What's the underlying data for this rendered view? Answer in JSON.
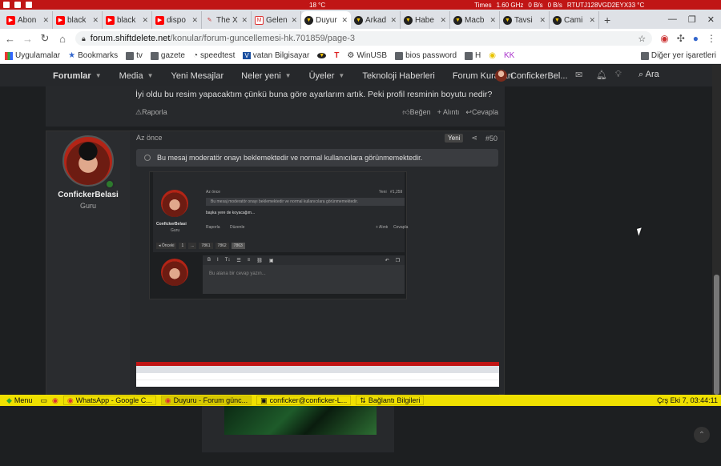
{
  "system_bar": {
    "items": [
      "18 °C",
      "Times",
      "1.60 GHz",
      "0 B/s",
      "0 B/s",
      "RTUTJ128VGD2EYX33 °C"
    ]
  },
  "tabs": [
    {
      "label": "Abon",
      "icon": "youtube-icon",
      "active": false
    },
    {
      "label": "black",
      "icon": "youtube-icon",
      "active": false
    },
    {
      "label": "black",
      "icon": "youtube-icon",
      "active": false
    },
    {
      "label": "dispo",
      "icon": "youtube-icon",
      "active": false
    },
    {
      "label": "The X",
      "icon": "pen-icon",
      "active": false
    },
    {
      "label": "Gelen",
      "icon": "gmail-icon",
      "active": false
    },
    {
      "label": "Duyur",
      "icon": "shiftdelete-icon",
      "active": true
    },
    {
      "label": "Arkad",
      "icon": "shiftdelete-icon",
      "active": false
    },
    {
      "label": "Habe",
      "icon": "shiftdelete-icon",
      "active": false
    },
    {
      "label": "Macb",
      "icon": "shiftdelete-icon",
      "active": false
    },
    {
      "label": "Tavsi",
      "icon": "shiftdelete-icon",
      "active": false
    },
    {
      "label": "Cami",
      "icon": "shiftdelete-icon",
      "active": false
    }
  ],
  "address": {
    "host": "forum.shiftdelete.net",
    "path": "/konular/forum-guncellemesi-hk.701859/page-3"
  },
  "bookmarks": {
    "items": [
      "Uygulamalar",
      "Bookmarks",
      "tv",
      "gazete",
      "speedtest",
      "vatan Bilgisayar",
      "",
      "",
      "WinUSB",
      "bios password",
      "H",
      "",
      "KK"
    ],
    "other": "Diğer yer işaretleri"
  },
  "forum_nav": {
    "items": [
      "Forumlar",
      "Media",
      "Yeni Mesajlar",
      "Neler yeni",
      "Üyeler",
      "Teknoloji Haberleri",
      "Forum Kuralları"
    ],
    "user": "ConfickerBel...",
    "search": "Ara"
  },
  "prev_post": {
    "text": "İyi oldu bu resim yapacaktım çünkü buna göre ayarlarım artık. Peki profil resminin boyutu nedir?",
    "report": "Raporla",
    "like": "Beğen",
    "quote": "+ Alıntı",
    "reply": "Cevapla"
  },
  "post": {
    "username": "ConfickerBelasi",
    "user_title": "Guru",
    "time": "Az önce",
    "badge": "Yeni",
    "number": "#50",
    "moderation_note": "Bu mesaj moderatör onayı beklemektedir ve normal kullanıcılara görünmemektedir."
  },
  "screenshot_inner": {
    "time": "Az önce",
    "badge": "Yeni",
    "number": "#1,259",
    "note": "Bu mesaj moderatör onayı beklemektedir ve normal kullanıcılara görünmemektedir.",
    "body": "başka yere de koyacağım...",
    "username": "ConfickerBelasi",
    "title": "Guru",
    "report": "Raporla",
    "edit": "Düzenle",
    "quote": "+ Alıntı",
    "reply": "Cevapla",
    "pages": [
      "◂ Önceki",
      "1",
      "...",
      "7861",
      "7862",
      "7863"
    ],
    "editor_placeholder": "Bu alana bir cevap yazın..."
  },
  "taskbar": {
    "menu": "Menu",
    "windows": [
      "WhatsApp - Google C...",
      "Duyuru - Forum günc...",
      "conficker@conficker-L...",
      "Bağlantı Bilgileri"
    ],
    "clock": "Çrş Eki 7, 03:44:11"
  }
}
